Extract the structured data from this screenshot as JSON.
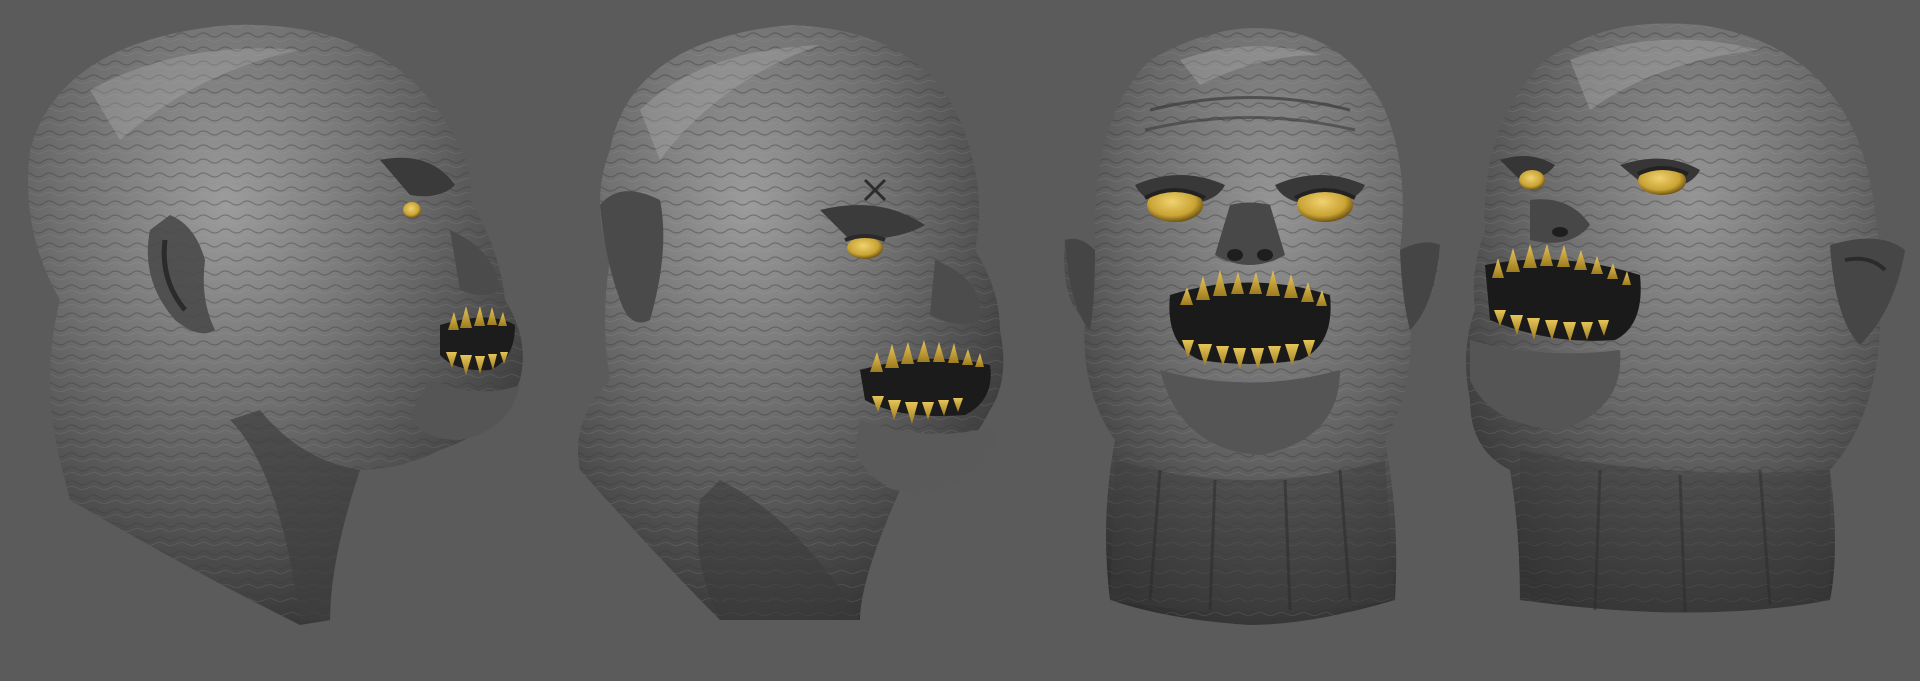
{
  "scene": {
    "description_none": "",
    "background_color": "#5b5b5b",
    "skin_color": "#6b6b6b",
    "skin_dark_color": "#2e2e2e",
    "skin_light_color": "#9a9a9a",
    "teeth_color": "#c9a332",
    "eye_color": "#c9a334",
    "views": [
      {
        "icon": "head-side-view-right"
      },
      {
        "icon": "head-three-quarter-view-right"
      },
      {
        "icon": "head-front-view"
      },
      {
        "icon": "head-three-quarter-view-left"
      }
    ]
  }
}
